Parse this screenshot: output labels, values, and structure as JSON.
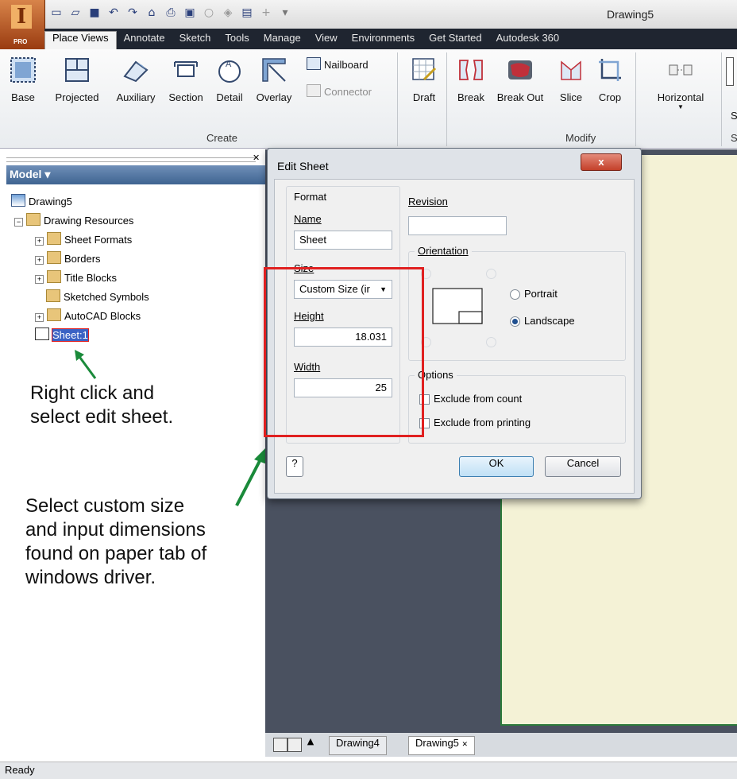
{
  "window": {
    "title": "Drawing5",
    "app_badge": "PRO"
  },
  "ribbon_tabs": [
    "Place Views",
    "Annotate",
    "Sketch",
    "Tools",
    "Manage",
    "View",
    "Environments",
    "Get Started",
    "Autodesk 360"
  ],
  "ribbon": {
    "create_buttons": [
      "Base",
      "Projected",
      "Auxiliary",
      "Section",
      "Detail",
      "Overlay"
    ],
    "nailboard": "Nailboard",
    "connector": "Connector",
    "draft": "Draft",
    "modify_buttons": [
      "Break",
      "Break Out",
      "Slice",
      "Crop"
    ],
    "horizontal": "Horizontal",
    "groups": {
      "create": "Create",
      "modify": "Modify"
    },
    "overflow_letter": "S"
  },
  "model_panel": {
    "header": "Model ▾",
    "tree": {
      "root": "Drawing5",
      "resources": "Drawing Resources",
      "children": [
        "Sheet Formats",
        "Borders",
        "Title Blocks",
        "Sketched Symbols",
        "AutoCAD Blocks"
      ],
      "sheet": "Sheet:1"
    }
  },
  "annotations": {
    "right_click": [
      "Right click and",
      "select edit sheet."
    ],
    "custom_size": [
      "Select custom size",
      "and input dimensions",
      "found on paper tab of",
      "windows driver."
    ]
  },
  "dialog": {
    "title": "Edit Sheet",
    "format_label": "Format",
    "name_label": "Name",
    "name_value": "Sheet",
    "size_label": "Size",
    "size_value": "Custom Size (ir",
    "height_label": "Height",
    "height_value": "18.031",
    "width_label": "Width",
    "width_value": "25",
    "revision_label": "Revision",
    "revision_value": "",
    "orientation_label": "Orientation",
    "portrait": "Portrait",
    "landscape": "Landscape",
    "orientation_selected": "Landscape",
    "options_label": "Options",
    "exclude_count": "Exclude from count",
    "exclude_printing": "Exclude from printing",
    "ok": "OK",
    "cancel": "Cancel",
    "close_glyph": "x",
    "help_glyph": "?"
  },
  "document_tabs": [
    "Drawing4",
    "Drawing5"
  ],
  "active_document": "Drawing5",
  "status": "Ready",
  "colors": {
    "highlight_box": "#e02020",
    "arrow": "#1a8a3a",
    "paper": "#f4f2d6"
  }
}
